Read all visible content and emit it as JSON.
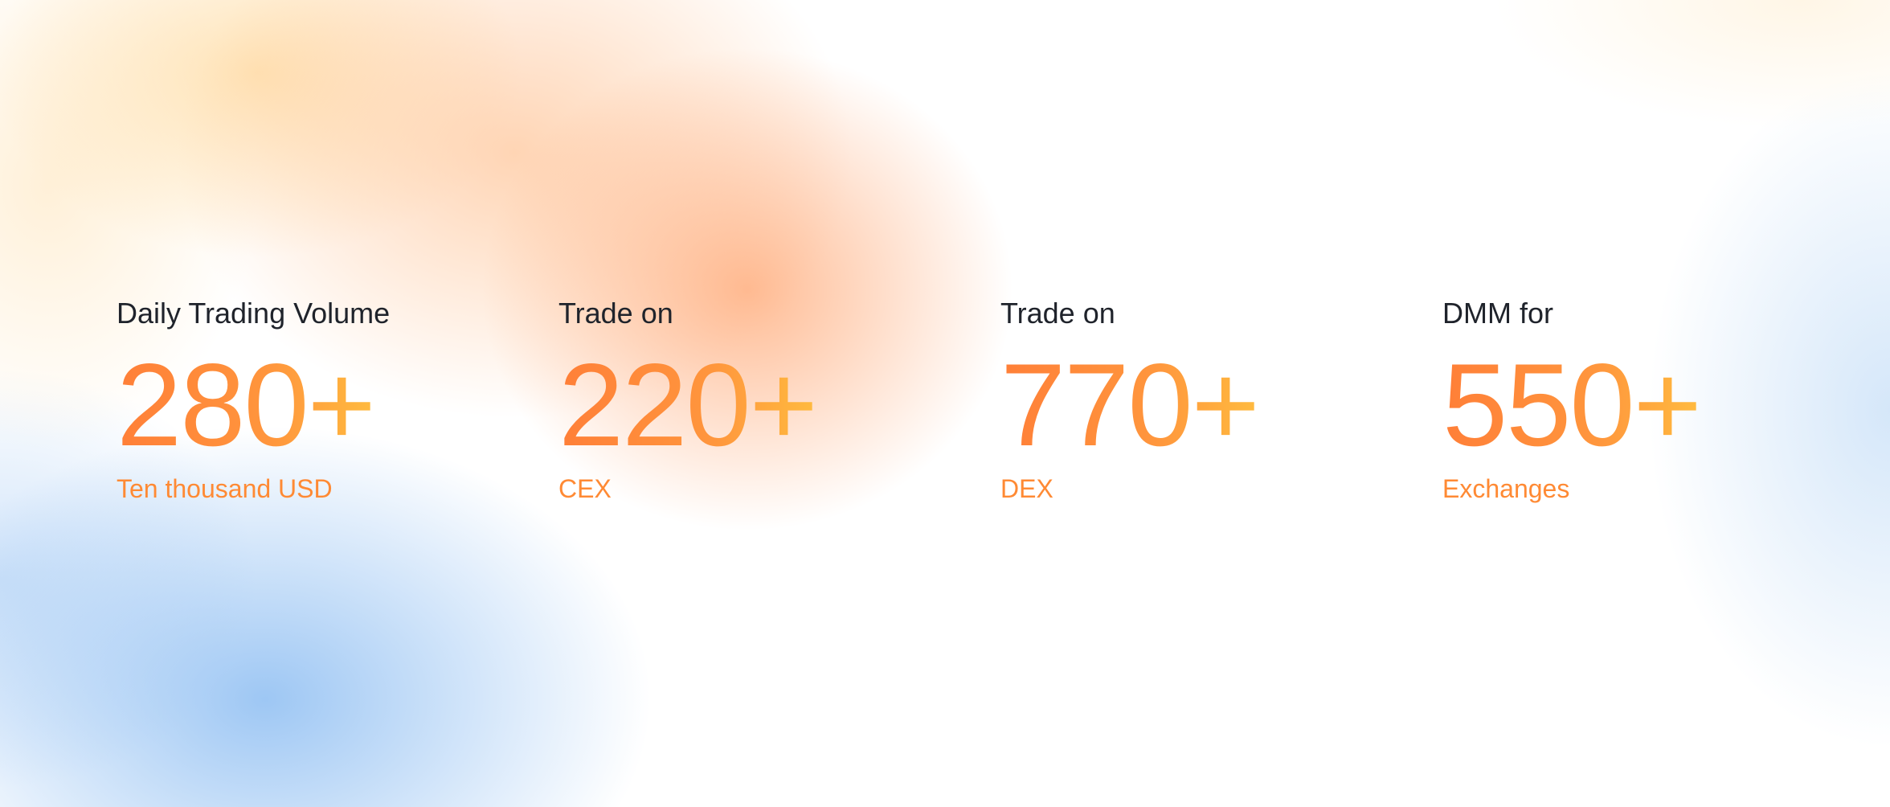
{
  "stats": [
    {
      "label": "Daily Trading Volume",
      "value": "280+",
      "unit": "Ten thousand USD"
    },
    {
      "label": "Trade on",
      "value": "220+",
      "unit": "CEX"
    },
    {
      "label": "Trade on",
      "value": "770+",
      "unit": "DEX"
    },
    {
      "label": "DMM for",
      "value": "550+",
      "unit": "Exchanges"
    }
  ],
  "colors": {
    "accent": "#ff8a3a",
    "accent_gradient_end": "#ffbb3f",
    "text": "#1f232b",
    "background_warm": "#ffb483",
    "background_cool": "#7db4f0"
  }
}
